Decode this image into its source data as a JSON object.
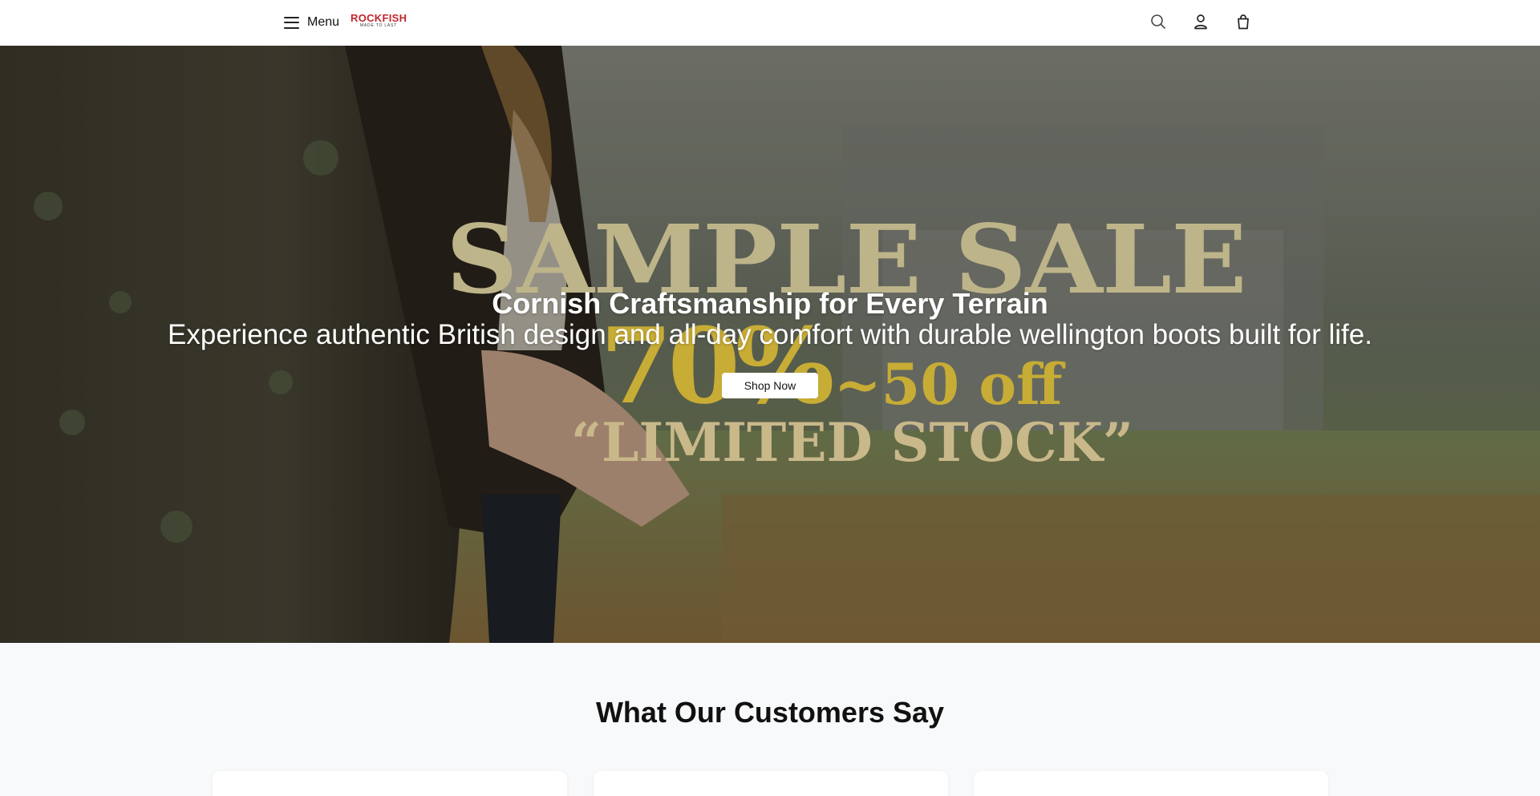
{
  "header": {
    "menu_label": "Menu",
    "logo": {
      "main": "ROCKFISH",
      "sub": "MADE TO LAST"
    },
    "icons": [
      "search-icon",
      "account-icon",
      "cart-icon"
    ]
  },
  "hero": {
    "promo_image": {
      "headline": "SAMPLE SALE",
      "discount": "70%",
      "discount_rest": "~50 off",
      "tagline": "“LIMITED STOCK”"
    },
    "title": "Cornish Craftsmanship for Every Terrain",
    "subtitle": "Experience authentic British design and all-day comfort with durable wellington boots built for life.",
    "cta_label": "Shop Now"
  },
  "testimonials": {
    "title": "What Our Customers Say",
    "cards": [
      {},
      {},
      {}
    ]
  },
  "colors": {
    "logo_red": "#c0272d",
    "sale_gold": "#c7ac35",
    "sale_beige": "#bdb48a",
    "header_bg": "#ffffff",
    "section_bg": "#f8f9fa"
  }
}
